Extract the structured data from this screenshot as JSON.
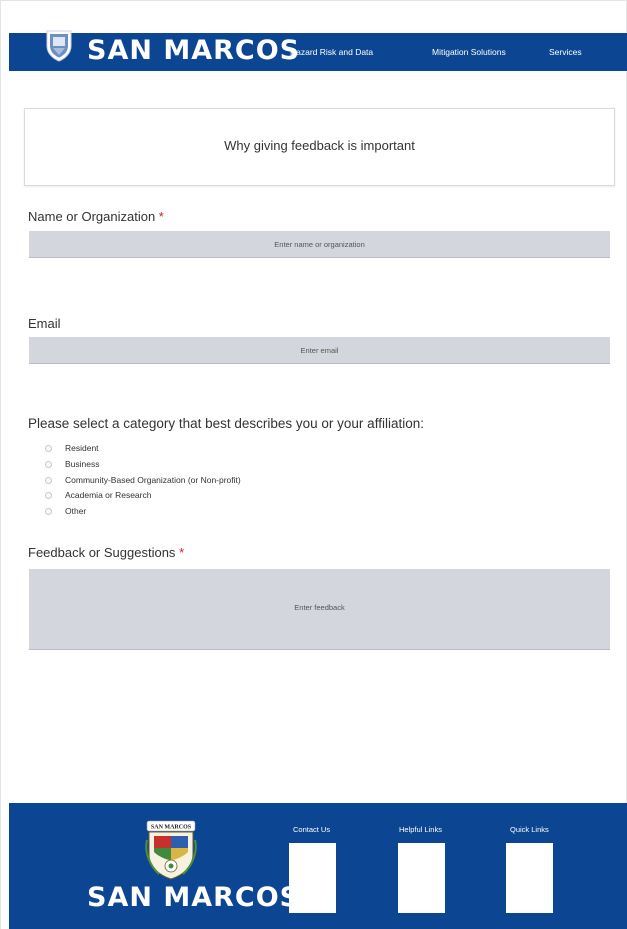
{
  "header": {
    "logo_text": "SAN MARCOS",
    "nav": [
      "Hazard Risk and Data",
      "Mitigation Solutions",
      "Services"
    ]
  },
  "info_card": {
    "title": "Why giving feedback is important"
  },
  "form": {
    "name": {
      "label": "Name or Organization",
      "required_mark": "*",
      "placeholder": "Enter name or organization"
    },
    "email": {
      "label": "Email",
      "placeholder": "Enter email"
    },
    "category": {
      "label": "Please select a category that best describes you or your affiliation:",
      "options": [
        "Resident",
        "Business",
        "Community-Based Organization (or Non-profit)",
        "Academia or Research",
        "Other"
      ]
    },
    "feedback": {
      "label": "Feedback or Suggestions",
      "required_mark": "*",
      "placeholder": "Enter feedback"
    }
  },
  "footer": {
    "seal_text": "SAN MARCOS",
    "logo_text": "SAN MARCOS",
    "headings": [
      "Contact Us",
      "Helpful Links",
      "Quick Links"
    ]
  },
  "colors": {
    "brand_blue": "#0c4693",
    "input_gray": "#d3d6dd",
    "required_red": "#d41c1c"
  }
}
